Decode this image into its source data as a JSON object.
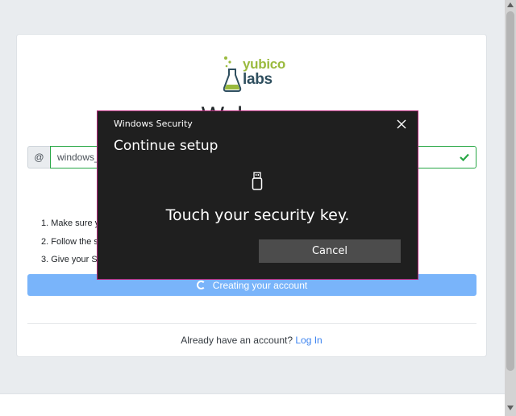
{
  "logo": {
    "line1": "yubico",
    "line2": "labs"
  },
  "page": {
    "heading": "Welcome",
    "username_prefix": "@",
    "username_value": "windows_",
    "steps": [
      "1. Make sure y",
      "2. Follow the s",
      "3. Give your Se"
    ],
    "progress_label": "Creating your account",
    "login_prompt": "Already have an account?",
    "login_link": "Log In"
  },
  "dialog": {
    "title": "Windows Security",
    "heading": "Continue setup",
    "message": "Touch your security key.",
    "cancel_label": "Cancel",
    "icon": "usb-key-icon",
    "border_color": "#b7277c"
  },
  "colors": {
    "accent": "#79b4fa",
    "success": "#28a745",
    "link": "#3d84f0"
  }
}
